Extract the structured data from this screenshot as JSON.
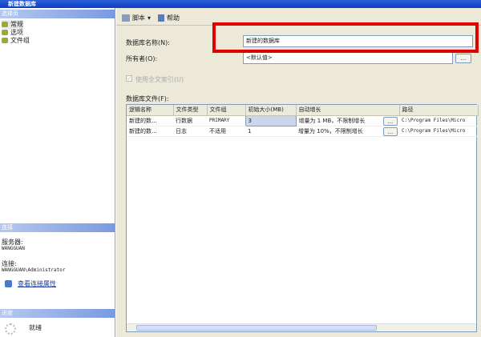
{
  "window": {
    "title": "新建数据库"
  },
  "left": {
    "select_page_header": "选择页",
    "nav": [
      {
        "label": "常规"
      },
      {
        "label": "选项"
      },
      {
        "label": "文件组"
      }
    ],
    "connection_header": "连接",
    "server_label": "服务器:",
    "server_value": "WANGGUAN",
    "connection_label": "连接:",
    "connection_value": "WANGGUAN\\Administrator",
    "view_connection_link": "查看连接属性",
    "progress_header": "进度",
    "progress_status": "就绪"
  },
  "toolbar": {
    "script_label": "脚本",
    "help_label": "帮助"
  },
  "form": {
    "db_name_label": "数据库名称(N):",
    "db_name_value": "新建的数据库",
    "owner_label": "所有者(O):",
    "owner_value": "<默认值>",
    "browse": "...",
    "fulltext_label": "使用全文索引(U)",
    "files_label": "数据库文件(F):"
  },
  "table": {
    "headers": [
      "逻辑名称",
      "文件类型",
      "文件组",
      "初始大小(MB)",
      "自动增长",
      "路径"
    ],
    "rows": [
      [
        "新建的数...",
        "行数据",
        "PRIMARY",
        "3",
        "增量为 1 MB，不限制增长",
        "C:\\Program Files\\Micro"
      ],
      [
        "新建的数...",
        "日志",
        "不适用",
        "1",
        "增量为 10%，不限制增长",
        "C:\\Program Files\\Micro"
      ]
    ],
    "browse": "..."
  },
  "colors": {
    "highlight": "#e00000",
    "titlebar": "#0a3ec4"
  }
}
